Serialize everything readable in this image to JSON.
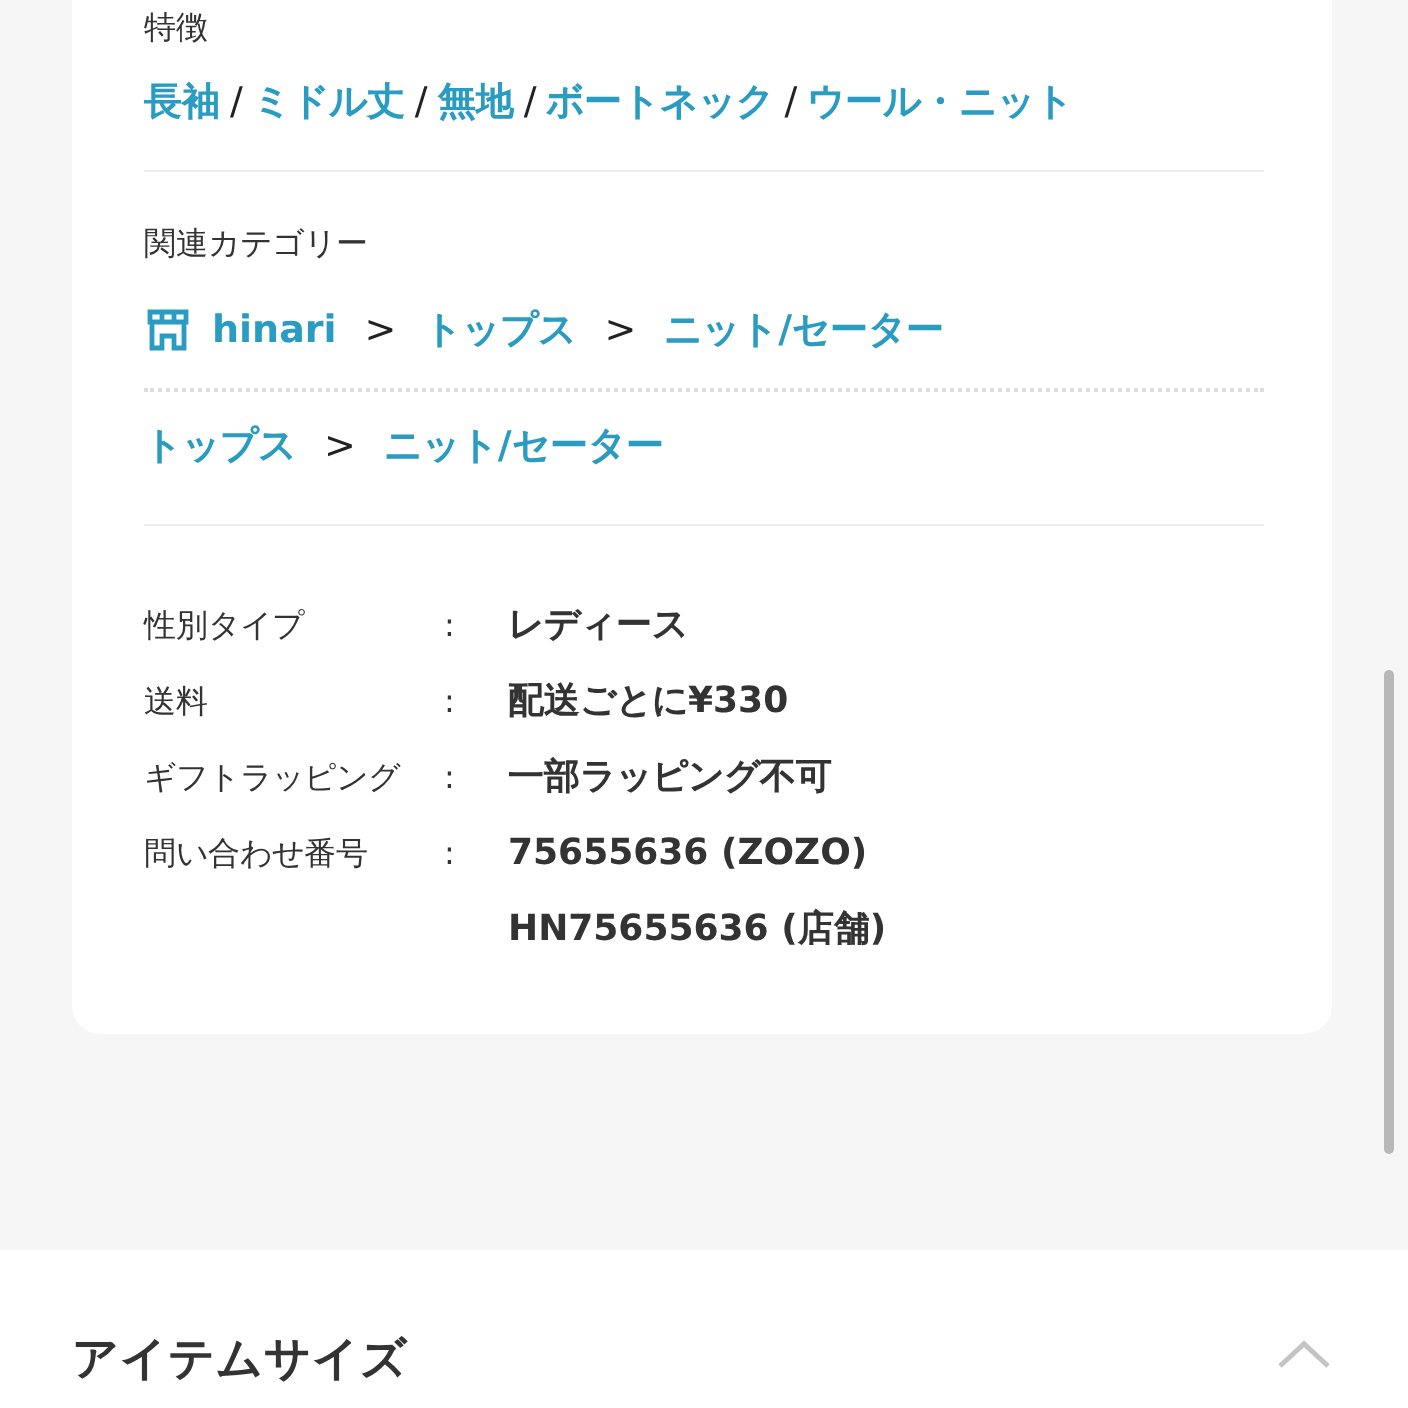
{
  "features": {
    "label": "特徴",
    "items": [
      {
        "kind": "link",
        "text": "長袖"
      },
      {
        "kind": "sep",
        "text": "/"
      },
      {
        "kind": "link",
        "text": "ミドル丈"
      },
      {
        "kind": "sep",
        "text": "/"
      },
      {
        "kind": "link",
        "text": "無地"
      },
      {
        "kind": "sep",
        "text": "/"
      },
      {
        "kind": "link",
        "text": "ボートネック"
      },
      {
        "kind": "sep",
        "text": "/"
      },
      {
        "kind": "link",
        "text": "ウール・ニット"
      }
    ]
  },
  "categories": {
    "label": "関連カテゴリー",
    "paths": [
      [
        {
          "kind": "shop",
          "text": "hinari"
        },
        {
          "kind": "sep",
          "text": ">"
        },
        {
          "kind": "link",
          "text": "トップス"
        },
        {
          "kind": "sep",
          "text": ">"
        },
        {
          "kind": "link",
          "text": "ニット/セーター"
        }
      ],
      [
        {
          "kind": "link",
          "text": "トップス"
        },
        {
          "kind": "sep",
          "text": ">"
        },
        {
          "kind": "link",
          "text": "ニット/セーター"
        }
      ]
    ]
  },
  "specs": [
    {
      "label": "性別タイプ",
      "colon": ":",
      "values": [
        "レディース"
      ]
    },
    {
      "label": "送料",
      "colon": ":",
      "values": [
        "配送ごとに¥330"
      ]
    },
    {
      "label": "ギフトラッピング",
      "colon": ":",
      "values": [
        "一部ラッピング不可"
      ]
    },
    {
      "label": "問い合わせ番号",
      "colon": ":",
      "values": [
        "75655636 (ZOZO)",
        "HN75655636 (店舗)"
      ]
    }
  ],
  "size_section": {
    "title": "アイテムサイズ",
    "expanded": true
  }
}
